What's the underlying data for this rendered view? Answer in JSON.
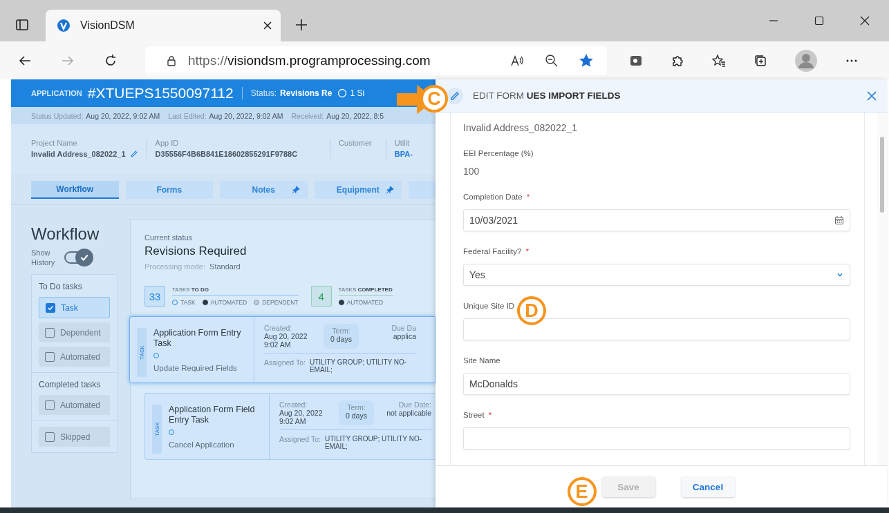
{
  "browser": {
    "tab_title": "VisionDSM",
    "url_scheme": "https://",
    "url_host": "visiondsm.programprocessing.com",
    "favorite": true
  },
  "application": {
    "label": "APPLICATION",
    "number": "#XTUEPS1550097112",
    "status_label": "Status:",
    "status_value": "Revisions Re",
    "sites": "1 Si"
  },
  "dates": [
    {
      "label": "Status Updated:",
      "value": "Aug 20, 2022, 9:02 AM"
    },
    {
      "label": "Last Edited:",
      "value": "Aug 20, 2022, 9:02 AM"
    },
    {
      "label": "Received:",
      "value": "Aug 20, 2022, 8:5"
    }
  ],
  "summary": [
    {
      "label": "Project Name",
      "value": "Invalid Address_082022_1",
      "kind": "editable"
    },
    {
      "label": "App ID",
      "value": "D35556F4B6B841E18602855291F9788C",
      "kind": "plain"
    },
    {
      "label": "Customer",
      "kind": "plain"
    },
    {
      "label": "Utilit",
      "value": "BPA-",
      "kind": "link"
    }
  ],
  "tabs": [
    {
      "label": "Workflow",
      "selected": true,
      "pinned": false
    },
    {
      "label": "Forms",
      "selected": false,
      "pinned": false
    },
    {
      "label": "Notes",
      "selected": false,
      "pinned": true
    },
    {
      "label": "Equipment",
      "selected": false,
      "pinned": true
    }
  ],
  "workflow": {
    "title": "Workflow",
    "history_label": "Show History",
    "history_on": true,
    "filter_groups": [
      {
        "title": "To Do tasks",
        "filters": [
          {
            "label": "Task",
            "checked": true,
            "selected": true
          },
          {
            "label": "Dependent",
            "checked": false,
            "selected": false
          },
          {
            "label": "Automated",
            "checked": false,
            "selected": false
          }
        ]
      },
      {
        "title": "Completed tasks",
        "filters": [
          {
            "label": "Automated",
            "checked": false,
            "selected": false
          }
        ]
      },
      {
        "filters": [
          {
            "label": "Skipped",
            "checked": false,
            "selected": false
          }
        ]
      }
    ],
    "status": {
      "caption": "Current status",
      "value": "Revisions Required",
      "mode_label": "Processing mode:",
      "mode_value": "Standard"
    },
    "counters": [
      {
        "count": "33",
        "title": "TASKS **TO DO**",
        "color": "#1e88e5",
        "legend": [
          {
            "label": "TASK",
            "kind": "hollow"
          },
          {
            "label": "AUTOMATED",
            "kind": "filled"
          },
          {
            "label": "DEPENDENT",
            "kind": "grey"
          }
        ]
      },
      {
        "count": "4",
        "title": "TASKS **COMPLETED**",
        "color": "#2e9e5b",
        "legend": [
          {
            "label": "AUTOMATED",
            "kind": "filled"
          }
        ]
      }
    ],
    "tasks": [
      {
        "type_label": "TASK",
        "title": "Application Form Entry Task",
        "action": "Update Required Fields",
        "created_label": "Created:",
        "created_date": "Aug 20, 2022",
        "created_time": "9:02 AM",
        "term_label": "Term:",
        "term": "0 days",
        "due_label": "Due Da",
        "due": "applica",
        "assigned_label": "Assigned To:",
        "assigned": "UTILITY GROUP; UTILITY NO-EMAIL;",
        "selected": true
      },
      {
        "type_label": "TASK",
        "title": "Application Form Field Entry Task",
        "action": "Cancel Application",
        "created_label": "Created:",
        "created_date": "Aug 20, 2022",
        "created_time": "9:02 AM",
        "term_label": "Term:",
        "term": "0 days",
        "due_label": "Due Date:",
        "due": "not applicable",
        "assigned_label": "Assigned To:",
        "assigned": "UTILITY GROUP; UTILITY NO-EMAIL;",
        "selected": false
      }
    ]
  },
  "edit_form": {
    "title": "EDIT FORM **UES IMPORT FIELDS**",
    "callout": "C",
    "fields": [
      {
        "kind": "readonly",
        "value": "Invalid Address_082022_1"
      },
      {
        "kind": "readonly",
        "label": "EEI Percentage (%)",
        "value": "100"
      },
      {
        "kind": "date",
        "label": "Completion Date",
        "marker": "*",
        "value": "10/03/2021"
      },
      {
        "kind": "select",
        "label": "Federal Facility?",
        "marker": "*",
        "value": "Yes"
      },
      {
        "kind": "input",
        "label": "Unique Site ID",
        "callout": "D"
      },
      {
        "kind": "input",
        "label": "Site Name",
        "value": "McDonalds"
      },
      {
        "kind": "input",
        "label": "Street",
        "marker": "*"
      }
    ],
    "buttons": [
      {
        "label": "Save",
        "disabled": true
      },
      {
        "label": "Cancel",
        "disabled": false
      }
    ],
    "footer_callout": "E"
  }
}
